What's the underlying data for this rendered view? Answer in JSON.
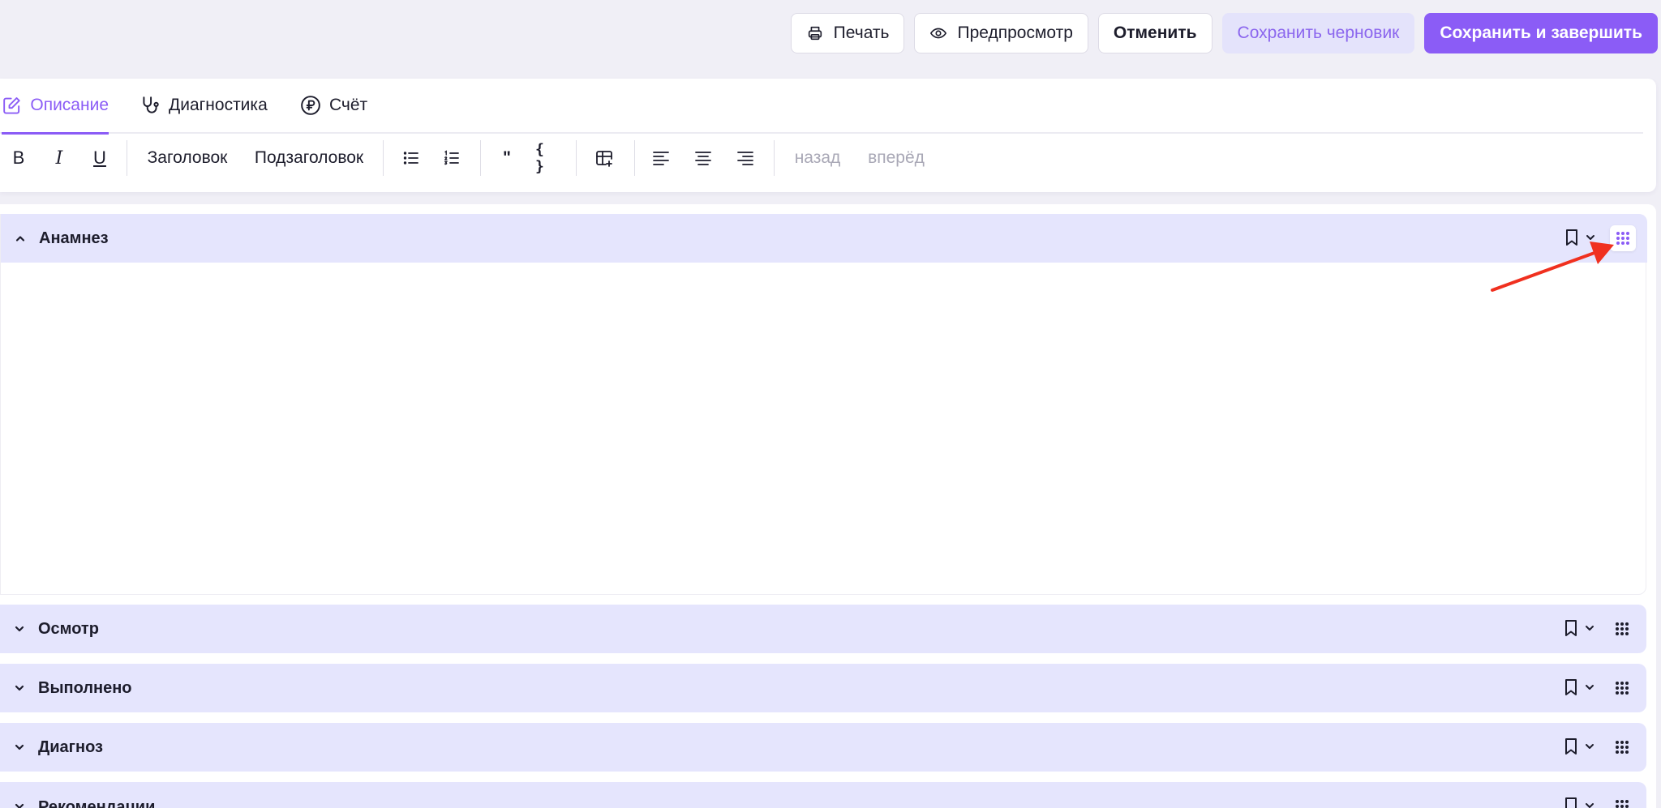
{
  "actions": {
    "print": "Печать",
    "preview": "Предпросмотр",
    "cancel": "Отменить",
    "save_draft": "Сохранить черновик",
    "save_finish": "Сохранить и завершить"
  },
  "tabs": [
    {
      "label": "Описание",
      "icon": "edit-icon",
      "active": true
    },
    {
      "label": "Диагностика",
      "icon": "stethoscope-icon",
      "active": false
    },
    {
      "label": "Счёт",
      "icon": "ruble-icon",
      "active": false
    }
  ],
  "toolbar": {
    "bold": "B",
    "italic": "I",
    "underline": "U",
    "heading": "Заголовок",
    "subheading": "Подзаголовок",
    "quote": "\"",
    "code": "{ }",
    "undo": "назад",
    "redo": "вперёд"
  },
  "sections": [
    {
      "title": "Анамнез",
      "expanded": true
    },
    {
      "title": "Осмотр",
      "expanded": false
    },
    {
      "title": "Выполнено",
      "expanded": false
    },
    {
      "title": "Диагноз",
      "expanded": false
    },
    {
      "title": "Рекомендации",
      "expanded": false
    }
  ],
  "colors": {
    "accent": "#8b5cf6",
    "section_header": "#e5e5fd",
    "annotation_arrow": "#f0301f"
  }
}
